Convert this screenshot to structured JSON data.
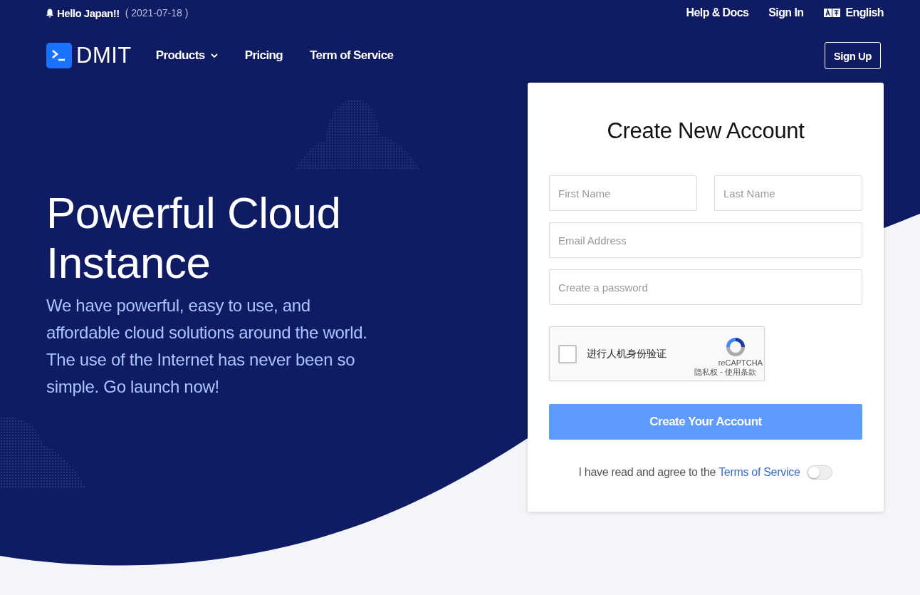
{
  "announcement": {
    "text": "Hello Japan!!",
    "date": "( 2021-07-18 )"
  },
  "top_links": [
    "Help & Docs",
    "Sign In"
  ],
  "language": "English",
  "brand": "DMIT",
  "nav": [
    {
      "label": "Products",
      "dropdown": true
    },
    {
      "label": "Pricing",
      "dropdown": false
    },
    {
      "label": "Term of Service",
      "dropdown": false
    }
  ],
  "signup_button": "Sign Up",
  "hero": {
    "title": "Powerful Cloud Instance",
    "text": "We have powerful, easy to use, and affordable cloud solutions around the world. The use of the Internet has never been so simple. Go launch now!"
  },
  "form": {
    "title": "Create New Account",
    "fields": [
      {
        "kind": "half",
        "placeholder": "First Name"
      },
      {
        "kind": "half",
        "placeholder": "Last Name"
      },
      {
        "kind": "full",
        "placeholder": "Email Address"
      },
      {
        "kind": "full",
        "placeholder": "Create a password"
      }
    ],
    "captcha": {
      "label": "进行人机身份验证",
      "checked": false,
      "brand": "reCAPTCHA",
      "privacy": "隐私权",
      "separator": "-",
      "terms": "使用条款"
    },
    "submit": "Create Your Account",
    "agreement": {
      "text": "I have read and agree to the",
      "link": "Terms of Service",
      "on": false
    }
  }
}
